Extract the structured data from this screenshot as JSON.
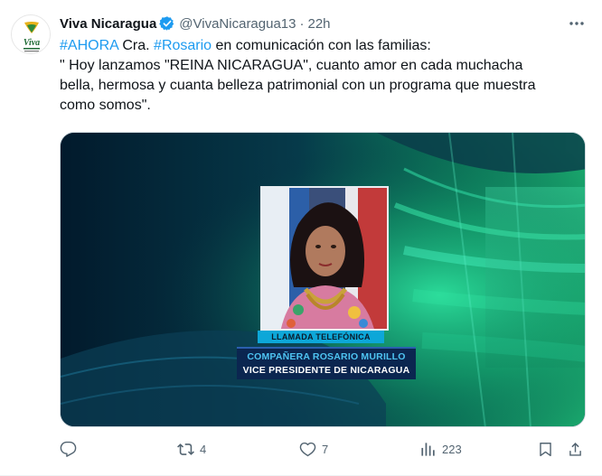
{
  "tweet": {
    "display_name": "Viva Nicaragua",
    "handle": "@VivaNicaragua13",
    "separator": "·",
    "time": "22h",
    "avatar_text": "Viva",
    "verified": true,
    "text": {
      "line1": {
        "hashtag1": "#AHORA",
        "mid": " Cra. ",
        "hashtag2": "#Rosario",
        "rest": " en comunicación con las familias:"
      },
      "line2": "\" Hoy lanzamos \"REINA NICARAGUA\", cuanto amor en cada muchacha",
      "line3": "bella, hermosa y cuanta belleza patrimonial con un programa que muestra",
      "line4": "como somos\"."
    },
    "media": {
      "caption_top": "LLAMADA TELEFÓNICA",
      "caption_name": "COMPAÑERA ROSARIO MURILLO",
      "caption_title": "VICE PRESIDENTE DE NICARAGUA"
    },
    "actions": {
      "replies": "",
      "retweets": "4",
      "likes": "7",
      "views": "223"
    }
  },
  "colors": {
    "accent": "#1d9bf0",
    "secondary_text": "#536471",
    "verified_badge": "#1d9bf0"
  },
  "icons": [
    "verified-badge-icon",
    "more-icon",
    "reply-icon",
    "retweet-icon",
    "like-icon",
    "views-icon",
    "bookmark-icon",
    "share-icon"
  ]
}
